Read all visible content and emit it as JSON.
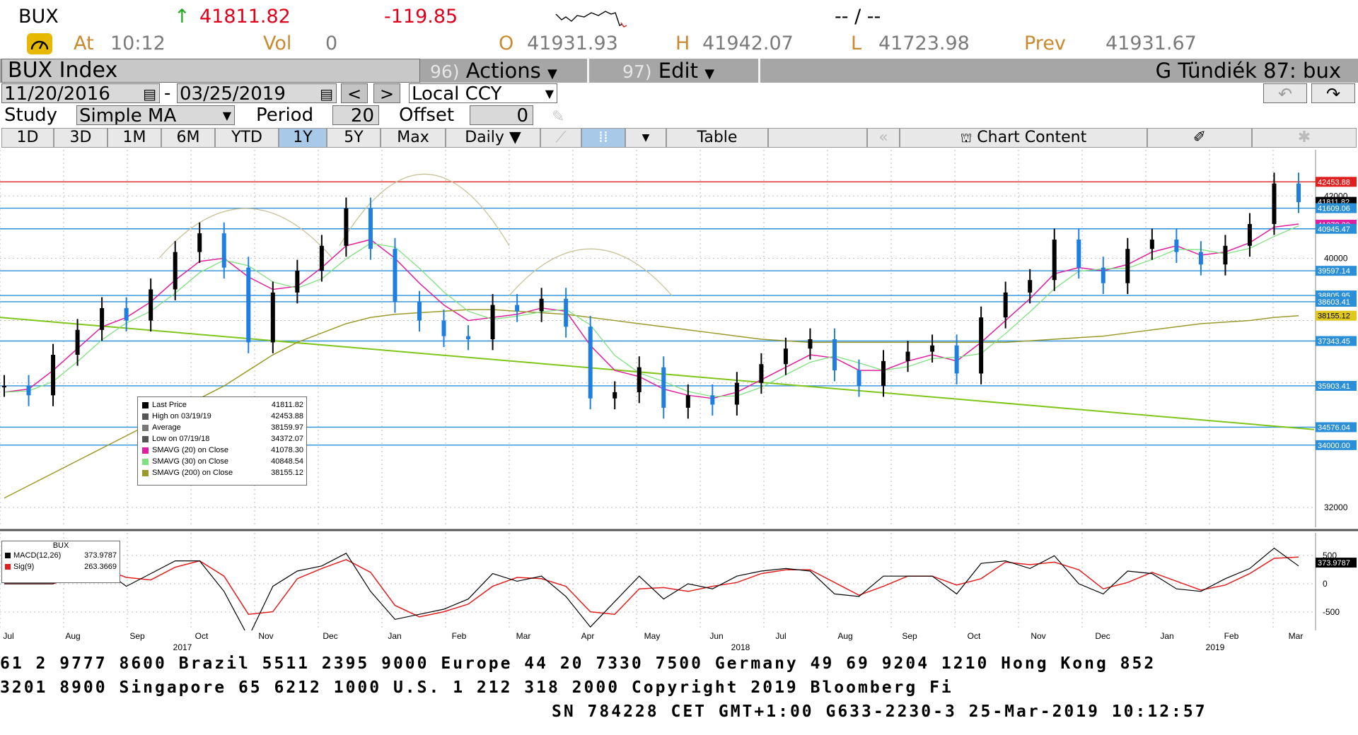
{
  "header": {
    "ticker": "BUX",
    "arrow": "↑",
    "last": "41811.82",
    "change": "-119.85",
    "bidask": "-- / --",
    "at_label": "At",
    "time": "10:12",
    "vol_label": "Vol",
    "vol": "0",
    "o_label": "O",
    "open": "41931.93",
    "h_label": "H",
    "high": "41942.07",
    "l_label": "L",
    "low": "41723.98",
    "prev_label": "Prev",
    "prev": "41931.67"
  },
  "titlebar": {
    "security": "BUX Index",
    "actions_num": "96)",
    "actions": "Actions",
    "edit_num": "97)",
    "edit": "Edit",
    "page": "G Tündiék 87: bux"
  },
  "controls": {
    "start_date": "11/20/2016",
    "dash": "-",
    "end_date": "03/25/2019",
    "prev_btn": "<",
    "next_btn": ">",
    "currency": "Local CCY",
    "study_label": "Study",
    "study": "Simple MA",
    "period_label": "Period",
    "period": "20",
    "offset_label": "Offset",
    "offset": "0"
  },
  "tabs": {
    "t1d": "1D",
    "t3d": "3D",
    "t1m": "1M",
    "t6m": "6M",
    "tytd": "YTD",
    "t1y": "1Y",
    "t5y": "5Y",
    "tmax": "Max",
    "daily": "Daily ▼",
    "table": "Table",
    "chart_content": "Chart Content"
  },
  "colors": {
    "price_up": "#000000",
    "price_down": "#1f7fe0",
    "sma20": "#e01f9e",
    "sma30": "#7fe07f",
    "sma200": "#9a9a2a",
    "hline": "#2b8fd8",
    "trend": "#7fc51a",
    "macd": "#000000",
    "signal": "#e01f1f"
  },
  "legend": {
    "rows": [
      {
        "label": "Last Price",
        "value": "41811.82"
      },
      {
        "label": "High on 03/19/19",
        "value": "42453.88"
      },
      {
        "label": "Average",
        "value": "38159.97"
      },
      {
        "label": "Low on 07/19/18",
        "value": "34372.07"
      },
      {
        "label": "SMAVG (20)  on Close",
        "value": "41078.30"
      },
      {
        "label": "SMAVG (30)  on Close",
        "value": "40848.54"
      },
      {
        "label": "SMAVG (200)  on Close",
        "value": "38155.12"
      }
    ]
  },
  "price_axis": {
    "ticks": [
      {
        "v": 40000,
        "t": "40000"
      },
      {
        "v": 32000,
        "t": "32000"
      },
      {
        "v": 42000,
        "t": "42000"
      }
    ],
    "tags": [
      {
        "v": 42453.88,
        "t": "42453.88",
        "color": "#e01f1f"
      },
      {
        "v": 41811.82,
        "t": "41811.82",
        "color": "#000000"
      },
      {
        "v": 41609.06,
        "t": "41609.06",
        "color": "#2b8fd8"
      },
      {
        "v": 41078.3,
        "t": "41078.30",
        "color": "#e01f9e"
      },
      {
        "v": 40945.47,
        "t": "40945.47",
        "color": "#2b8fd8"
      },
      {
        "v": 39597.14,
        "t": "39597.14",
        "color": "#2b8fd8"
      },
      {
        "v": 38805.95,
        "t": "38805.95",
        "color": "#2b8fd8"
      },
      {
        "v": 38603.41,
        "t": "38603.41",
        "color": "#2b8fd8"
      },
      {
        "v": 38155.12,
        "t": "38155.12",
        "color": "#e0c81f"
      },
      {
        "v": 37343.45,
        "t": "37343.45",
        "color": "#2b8fd8"
      },
      {
        "v": 35903.41,
        "t": "35903.41",
        "color": "#2b8fd8"
      },
      {
        "v": 34576.04,
        "t": "34576.04",
        "color": "#2b8fd8"
      },
      {
        "v": 34000.0,
        "t": "34000.00",
        "color": "#2b8fd8"
      }
    ]
  },
  "macd": {
    "title": "BUX",
    "rows": [
      {
        "label": "MACD(12,26)",
        "value": "373.9787"
      },
      {
        "label": "Sig(9)",
        "value": "263.3669"
      }
    ],
    "axis": [
      {
        "v": 500,
        "t": "500"
      },
      {
        "v": 0,
        "t": "0"
      },
      {
        "v": -500,
        "t": "-500"
      }
    ],
    "tag": "373.9787"
  },
  "xaxis": {
    "months": [
      "Jul",
      "Aug",
      "Sep",
      "Oct",
      "Nov",
      "Dec",
      "Jan",
      "Feb",
      "Mar",
      "Apr",
      "May",
      "Jun",
      "Jul",
      "Aug",
      "Sep",
      "Oct",
      "Nov",
      "Dec",
      "Jan",
      "Feb",
      "Mar"
    ],
    "years": [
      "2017",
      "2018",
      "2019"
    ]
  },
  "chart_data": {
    "type": "line",
    "ylim": [
      31500,
      43300
    ],
    "y_unit": "index points",
    "x_start": "Jul 2017",
    "x_end": "Mar 2019",
    "series": [
      {
        "name": "Last Price",
        "values": [
          35900,
          35600,
          36900,
          37700,
          38400,
          38000,
          39000,
          40200,
          40800,
          39700,
          37300,
          38900,
          39600,
          40400,
          41600,
          40300,
          38600,
          38000,
          37500,
          37400,
          38500,
          38300,
          38700,
          37800,
          35500,
          35700,
          36500,
          35200,
          35600,
          35300,
          36000,
          36600,
          37100,
          37400,
          36400,
          35900,
          36700,
          37000,
          37200,
          36300,
          38100,
          38900,
          39300,
          40600,
          39700,
          39200,
          40300,
          40600,
          40200,
          39800,
          40400,
          41100,
          42400,
          41800
        ]
      },
      {
        "name": "SMAVG (20)",
        "values": [
          35700,
          35800,
          36400,
          37100,
          37800,
          38100,
          38600,
          39300,
          39900,
          40000,
          39400,
          39000,
          39100,
          39700,
          40400,
          40600,
          40000,
          39200,
          38500,
          38000,
          38100,
          38200,
          38400,
          38300,
          37200,
          36400,
          36200,
          35800,
          35600,
          35500,
          35700,
          36100,
          36500,
          36900,
          36800,
          36400,
          36400,
          36700,
          36900,
          36700,
          37300,
          38000,
          38700,
          39500,
          39700,
          39600,
          39800,
          40200,
          40400,
          40100,
          40200,
          40500,
          41000,
          41100
        ]
      },
      {
        "name": "SMAVG (200)",
        "values": [
          32300,
          32700,
          33100,
          33500,
          33900,
          34300,
          34700,
          35100,
          35500,
          35900,
          36400,
          36900,
          37300,
          37600,
          37900,
          38100,
          38200,
          38250,
          38300,
          38350,
          38350,
          38300,
          38250,
          38200,
          38100,
          38000,
          37900,
          37800,
          37700,
          37600,
          37500,
          37400,
          37350,
          37300,
          37300,
          37300,
          37300,
          37300,
          37300,
          37300,
          37300,
          37300,
          37350,
          37400,
          37450,
          37500,
          37600,
          37700,
          37800,
          37900,
          37950,
          38000,
          38100,
          38155
        ]
      }
    ],
    "hlines": [
      42453.88,
      41609.06,
      40945.47,
      39597.14,
      38805.95,
      38603.41,
      37343.45,
      35903.41,
      34576.04,
      34000.0
    ]
  },
  "footer": {
    "line1": "61 2 9777 8600 Brazil 5511 2395 9000 Europe 44 20 7330 7500 Germany 49 69 9204 1210 Hong Kong 852",
    "line2": " 3201 8900        Singapore 65 6212 1000        U.S. 1 212 318 2000        Copyright 2019 Bloomberg Fi",
    "line3": "SN 784228 CET  GMT+1:00 G633-2230-3 25-Mar-2019 10:12:57"
  }
}
